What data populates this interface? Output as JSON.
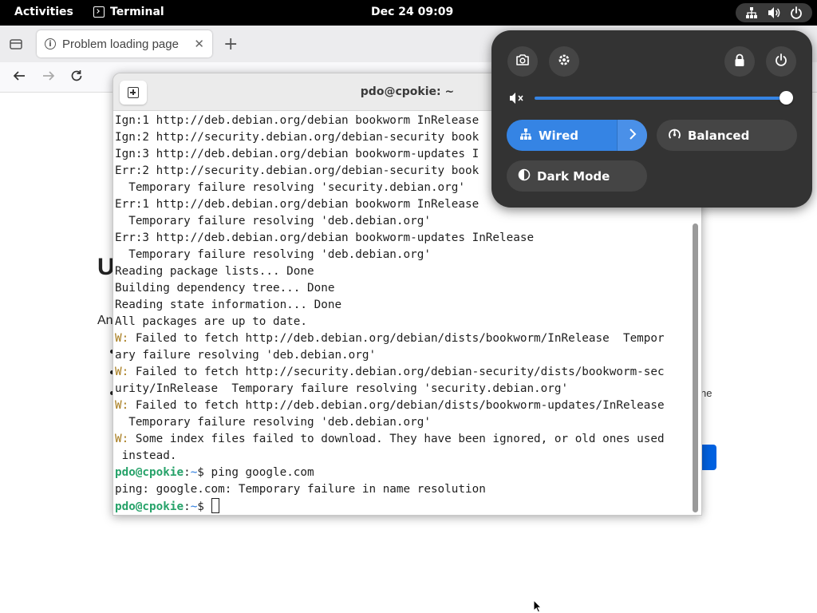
{
  "topbar": {
    "activities": "Activities",
    "app_name": "Terminal",
    "clock": "Dec 24  09:09"
  },
  "browser": {
    "tab_title": "Problem loading page",
    "heading_peek": "U",
    "text_peek": "An",
    "right_text_peek": "ne"
  },
  "terminal": {
    "title": "pdo@cpokie: ~",
    "lines": [
      {
        "parts": [
          {
            "t": "Ign:1 http://deb.debian.org/debian bookworm InRelease"
          }
        ]
      },
      {
        "parts": [
          {
            "t": "Ign:2 http://security.debian.org/debian-security book"
          }
        ]
      },
      {
        "parts": [
          {
            "t": "Ign:3 http://deb.debian.org/debian bookworm-updates I"
          }
        ]
      },
      {
        "parts": [
          {
            "t": "Err:2 http://security.debian.org/debian-security book"
          }
        ]
      },
      {
        "parts": [
          {
            "t": "  Temporary failure resolving 'security.debian.org'"
          }
        ]
      },
      {
        "parts": [
          {
            "t": "Err:1 http://deb.debian.org/debian bookworm InRelease"
          }
        ]
      },
      {
        "parts": [
          {
            "t": "  Temporary failure resolving 'deb.debian.org'"
          }
        ]
      },
      {
        "parts": [
          {
            "t": "Err:3 http://deb.debian.org/debian bookworm-updates InRelease"
          }
        ]
      },
      {
        "parts": [
          {
            "t": "  Temporary failure resolving 'deb.debian.org'"
          }
        ]
      },
      {
        "parts": [
          {
            "t": "Reading package lists... Done"
          }
        ]
      },
      {
        "parts": [
          {
            "t": "Building dependency tree... Done"
          }
        ]
      },
      {
        "parts": [
          {
            "t": "Reading state information... Done"
          }
        ]
      },
      {
        "parts": [
          {
            "t": "All packages are up to date."
          }
        ]
      },
      {
        "parts": [
          {
            "t": "W:",
            "c": "warn"
          },
          {
            "t": " Failed to fetch http://deb.debian.org/debian/dists/bookworm/InRelease  Tempor"
          }
        ]
      },
      {
        "parts": [
          {
            "t": "ary failure resolving 'deb.debian.org'"
          }
        ]
      },
      {
        "parts": [
          {
            "t": "W:",
            "c": "warn"
          },
          {
            "t": " Failed to fetch http://security.debian.org/debian-security/dists/bookworm-sec"
          }
        ]
      },
      {
        "parts": [
          {
            "t": "urity/InRelease  Temporary failure resolving 'security.debian.org'"
          }
        ]
      },
      {
        "parts": [
          {
            "t": "W:",
            "c": "warn"
          },
          {
            "t": " Failed to fetch http://deb.debian.org/debian/dists/bookworm-updates/InRelease"
          }
        ]
      },
      {
        "parts": [
          {
            "t": "  Temporary failure resolving 'deb.debian.org'"
          }
        ]
      },
      {
        "parts": [
          {
            "t": "W:",
            "c": "warn"
          },
          {
            "t": " Some index files failed to download. They have been ignored, or old ones used"
          }
        ]
      },
      {
        "parts": [
          {
            "t": " instead."
          }
        ]
      },
      {
        "parts": [
          {
            "t": "pdo@cpokie",
            "c": "prompt"
          },
          {
            "t": ":"
          },
          {
            "t": "~",
            "c": "pathc"
          },
          {
            "t": "$ ping google.com"
          }
        ]
      },
      {
        "parts": [
          {
            "t": "ping: google.com: Temporary failure in name resolution"
          }
        ]
      },
      {
        "parts": [
          {
            "t": "pdo@cpokie",
            "c": "prompt"
          },
          {
            "t": ":"
          },
          {
            "t": "~",
            "c": "pathc"
          },
          {
            "t": "$ "
          }
        ],
        "cursor": true
      }
    ]
  },
  "quick_settings": {
    "volume_level": 1.0,
    "wired_label": "Wired",
    "power_label": "Balanced",
    "dark_mode_label": "Dark Mode"
  },
  "colors": {
    "accent": "#3584e4",
    "prompt_green": "#26a269",
    "warning": "#a77b1c",
    "panel_bg": "#333333"
  },
  "icons": {
    "topbar": [
      "network-wired-icon",
      "volume-icon",
      "power-icon"
    ],
    "qs_top": [
      "screenshot-icon",
      "settings-gear-icon",
      "lock-icon",
      "power-off-icon"
    ]
  }
}
